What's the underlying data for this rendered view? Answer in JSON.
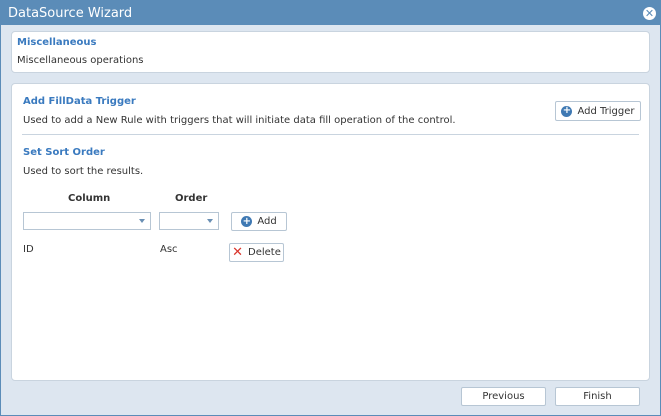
{
  "window": {
    "title": "DataSource Wizard",
    "close_icon": "close-icon"
  },
  "header": {
    "title": "Miscellaneous",
    "description": "Miscellaneous operations"
  },
  "filldata": {
    "title": "Add FillData Trigger",
    "description": "Used to add a New Rule with triggers that will initiate data fill operation of the control.",
    "add_trigger_label": "Add Trigger"
  },
  "sort": {
    "title": "Set Sort Order",
    "description": "Used to sort the results.",
    "column_header": "Column",
    "order_header": "Order",
    "column_select_value": "",
    "order_select_value": "",
    "add_label": "Add",
    "rows": [
      {
        "column": "ID",
        "order": "Asc",
        "delete_label": "Delete"
      }
    ]
  },
  "footer": {
    "previous_label": "Previous",
    "finish_label": "Finish"
  },
  "colors": {
    "titlebar": "#5b8cb8",
    "section_title": "#3a7abf",
    "delete_icon": "#d9342b",
    "add_icon": "#3f79b3"
  }
}
